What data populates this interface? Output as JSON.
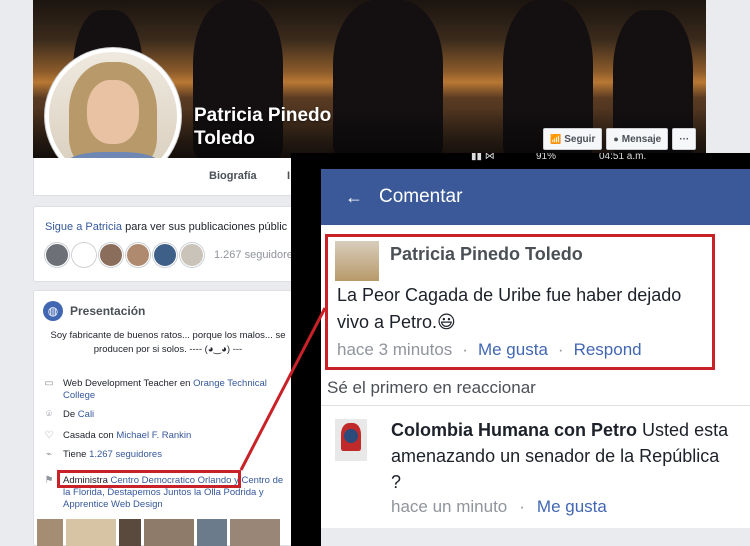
{
  "profile": {
    "name": "Patricia Pinedo Toledo",
    "follow_button": "Seguir",
    "message_button": "Mensaje",
    "more_button": "···"
  },
  "tabs": {
    "bio": "Biografía",
    "next": "I"
  },
  "follow": {
    "link": "Sigue a Patricia",
    "rest": " para ver sus publicaciones públic",
    "count": "1.267 seguidore"
  },
  "intro": {
    "title": "Presentación",
    "bio": "Soy fabricante de buenos ratos... porque los malos... se producen por si solos. ---- (◕‿◕) ---",
    "work_prefix": "Web Development Teacher en ",
    "work_link": "Orange Technical College",
    "from_prefix": "De ",
    "from_link": "Cali",
    "married_prefix": "Casada con ",
    "married_link": "Michael F. Rankin",
    "followers_prefix": "Tiene ",
    "followers_link": "1.267 seguidores",
    "admin_prefix": "Administra ",
    "admin_link": "Centro Democratico Orlando y Centro de la Florida, Destapemos Juntos la Olla Podrida y Apprentice Web Design"
  },
  "phone": {
    "status_signal": "91%",
    "status_time": "04:51 a.m.",
    "appbar_title": "Comentar",
    "comment": {
      "author": "Patricia Pinedo Toledo",
      "text": "La Peor Cagada de Uribe fue haber dejado vivo a Petro.😃",
      "time": "hace 3 minutos",
      "like": "Me gusta",
      "reply": "Respond"
    },
    "reactions": "Sé el primero en reaccionar",
    "reply": {
      "author": "Colombia Humana con Petro",
      "text": " Usted esta amenazando un senador de la República ?",
      "time": "hace un minuto",
      "like": "Me gusta"
    }
  },
  "colors": {
    "facebook_blue": "#3b5998",
    "link": "#365899",
    "highlight_red": "#c82127"
  },
  "icons": [
    "back-arrow-icon",
    "globe-icon",
    "briefcase-icon",
    "location-pin-icon",
    "heart-icon",
    "rss-icon",
    "flag-icon",
    "follow-icon",
    "message-icon"
  ]
}
